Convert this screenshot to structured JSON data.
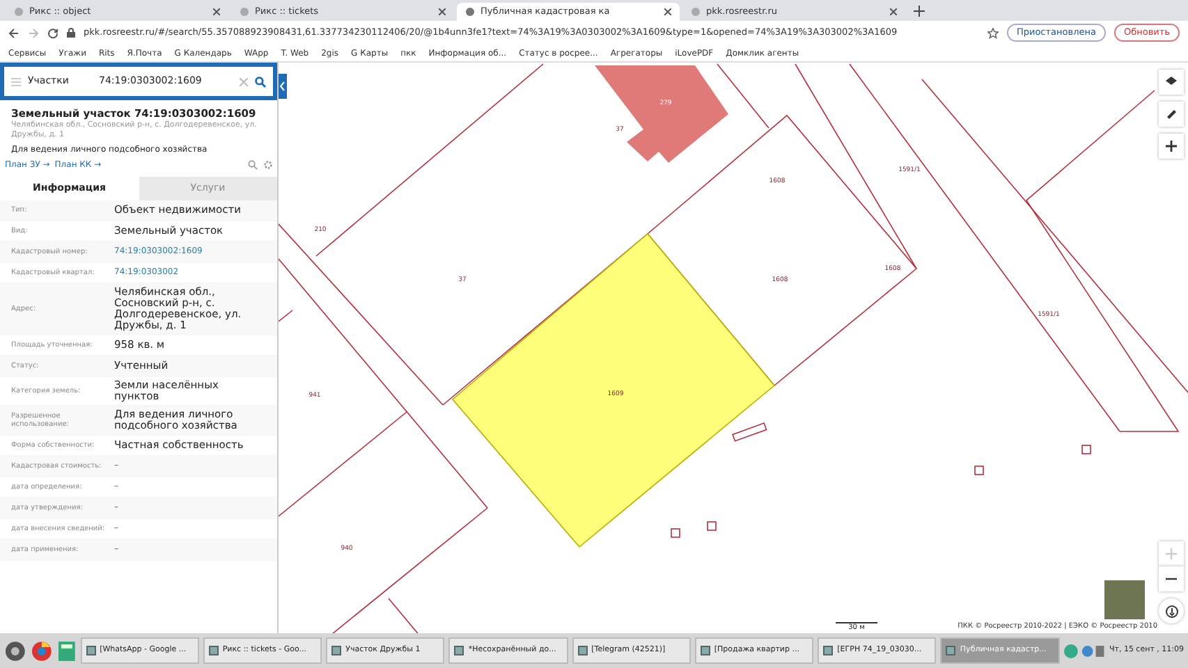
{
  "browser": {
    "tabs": [
      {
        "title": "Рикс :: object",
        "selected": false
      },
      {
        "title": "Рикс :: tickets",
        "selected": false
      },
      {
        "title": "Публичная кадастровая ка",
        "selected": true
      },
      {
        "title": "pkk.rosreestr.ru",
        "selected": false
      }
    ],
    "url": "pkk.rosreestr.ru/#/search/55.357088923908431,61.337734230112406/20/@1b4unn3fe1?text=74%3A19%3A0303002%3A1609&type=1&opened=74%3A19%3A303002%3A1609",
    "status_button": "Приостановлена",
    "update_button": "Обновить",
    "bookmarks": [
      "Сервисы",
      "Угажи",
      "Rits",
      "Я.Почта",
      "G Календарь",
      "WApp",
      "T. Web",
      "2gis",
      "G Карты",
      "пкк",
      "Информация об...",
      "Статус в росрее...",
      "Агрегаторы",
      "iLovePDF",
      "Домклик агенты"
    ]
  },
  "search": {
    "category": "Участки",
    "query": "74:19:0303002:1609"
  },
  "object": {
    "title": "Земельный участок 74:19:0303002:1609",
    "address": "Челябинская обл., Сосновский р-н, с. Долгодеревенское, ул. Дружбы, д. 1",
    "purpose": "Для ведения личного подсобного хозяйства",
    "links": [
      "План ЗУ →",
      "План КК →"
    ]
  },
  "info_tabs": [
    {
      "label": "Информация",
      "selected": true
    },
    {
      "label": "Услуги",
      "selected": false
    }
  ],
  "fields": [
    {
      "label": "Тип:",
      "value": "Объект недвижимости",
      "kind": "text"
    },
    {
      "label": "Вид:",
      "value": "Земельный участок",
      "kind": "text"
    },
    {
      "label": "Кадастровый номер:",
      "value": "74:19:0303002:1609",
      "kind": "link"
    },
    {
      "label": "Кадастровый квартал:",
      "value": "74:19:0303002",
      "kind": "link"
    },
    {
      "label": "Адрес:",
      "value": "Челябинская обл., Сосновский р-н, с. Долгодеревенское, ул. Дружбы, д. 1",
      "kind": "text"
    },
    {
      "label": "Площадь уточненная:",
      "value": "958 кв. м",
      "kind": "text"
    },
    {
      "label": "Статус:",
      "value": "Учтенный",
      "kind": "text"
    },
    {
      "label": "Категория земель:",
      "value": "Земли населённых пунктов",
      "kind": "text"
    },
    {
      "label": "Разрешенное использование:",
      "value": "Для ведения личного подсобного хозяйства",
      "kind": "text"
    },
    {
      "label": "Форма собственности:",
      "value": "Частная собственность",
      "kind": "text"
    },
    {
      "label": "Кадастровая стоимость:",
      "value": "–",
      "kind": "plain"
    },
    {
      "label": "дата определения:",
      "value": "–",
      "kind": "plain"
    },
    {
      "label": "дата утверждения:",
      "value": "–",
      "kind": "plain"
    },
    {
      "label": "дата внесения сведений:",
      "value": "–",
      "kind": "plain"
    },
    {
      "label": "дата применения:",
      "value": "–",
      "kind": "plain"
    }
  ],
  "map": {
    "labels": [
      "279",
      "37",
      "1608",
      "210",
      "37",
      "1608",
      "1608",
      "1591/1",
      "1591/1",
      "941",
      "1609",
      "940"
    ],
    "scale": "30 м",
    "attribution": "ПКК © Росреестр 2010-2022 | ЕЭКО © Росреестр 2010",
    "zoom_in_disabled": true
  },
  "taskbar": {
    "items": [
      {
        "title": "[WhatsApp - Google ...",
        "selected": false
      },
      {
        "title": "Рикс :: tickets - Goo...",
        "selected": false
      },
      {
        "title": "Участок Дружбы 1",
        "selected": false
      },
      {
        "title": "*Несохранённый до...",
        "selected": false
      },
      {
        "title": "[Telegram (42521)]",
        "selected": false
      },
      {
        "title": "[Продажа квартир ...",
        "selected": false
      },
      {
        "title": "[ЕГРН 74_19_03030...",
        "selected": false
      },
      {
        "title": "Публичная кадастр...",
        "selected": true
      }
    ],
    "clock": "Чт, 15 сент , 11:09"
  }
}
